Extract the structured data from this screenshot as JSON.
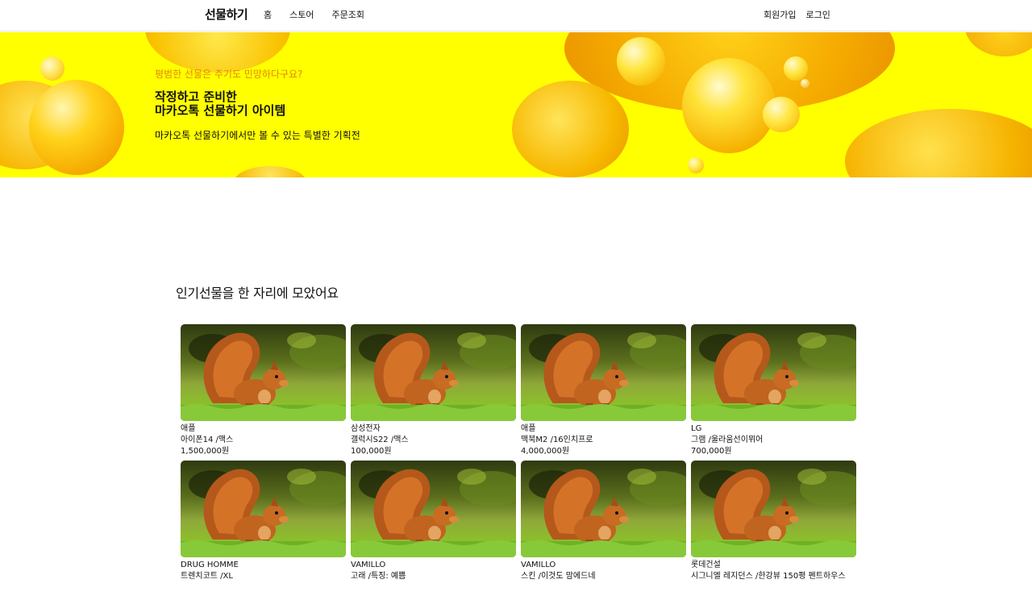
{
  "nav": {
    "brand": "선물하기",
    "menu": [
      "홈",
      "스토어",
      "주문조회"
    ],
    "auth": [
      "회원가입",
      "로그인"
    ]
  },
  "hero": {
    "eyebrow": "평범한 선물은 주기도 민망하다구요?",
    "headline_line1": "작정하고 준비한",
    "headline_line2": "마카오톡 선물하기 아이템",
    "sub": "마카오톡 선물하기에서만 볼 수 있는 특별한 기획전",
    "accent_color": "#ffff00",
    "eyebrow_color": "#e08a00"
  },
  "section": {
    "title": "인기선물을 한 자리에 모았어요"
  },
  "products": [
    {
      "brand": "애플",
      "name": "아이폰14 /맥스",
      "price": "1,500,000원",
      "image": "squirrel-photo"
    },
    {
      "brand": "삼성전자",
      "name": "갤럭시S22 /맥스",
      "price": "100,000원",
      "image": "squirrel-photo"
    },
    {
      "brand": "애플",
      "name": "맥북M2 /16인치프로",
      "price": "4,000,000원",
      "image": "squirrel-photo"
    },
    {
      "brand": "LG",
      "name": "그램 /울라움선이뮈어",
      "price": "700,000원",
      "image": "squirrel-photo"
    },
    {
      "brand": "DRUG HOMME",
      "name": "트렌치코트 /XL",
      "price": "",
      "image": "squirrel-photo"
    },
    {
      "brand": "VAMILLO",
      "name": "고래 /특징: 예쁨",
      "price": "",
      "image": "squirrel-photo"
    },
    {
      "brand": "VAMILLO",
      "name": "스킨 /이것도 맘에드네",
      "price": "",
      "image": "squirrel-photo"
    },
    {
      "brand": "롯데건설",
      "name": "시그니엘 레지던스 /한강뷰 150평 펜트하우스",
      "price": "",
      "image": "squirrel-photo"
    }
  ]
}
